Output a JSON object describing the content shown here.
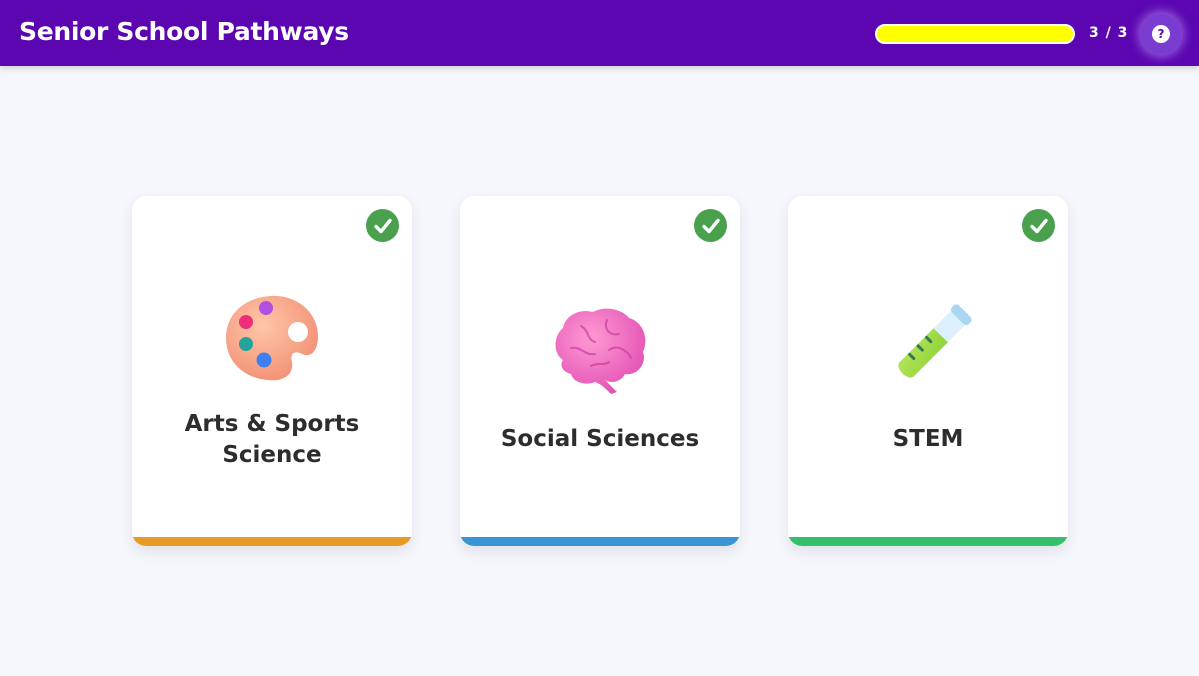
{
  "header": {
    "title": "Senior School Pathways",
    "progress": {
      "current": 3,
      "total": 3,
      "fraction": 1.0,
      "text": "3 / 3",
      "fill_color": "#ffff00"
    },
    "help_label": "?"
  },
  "colors": {
    "header_bg": "#5b06b1",
    "page_bg": "#f6f7fc",
    "check_bg": "#4aa14d"
  },
  "pathways": [
    {
      "label_line1": "Arts & Sports",
      "label_line2": "Science",
      "icon": "palette-icon",
      "accent": "#e89a26",
      "completed": true
    },
    {
      "label_line1": "Social Sciences",
      "label_line2": "",
      "icon": "brain-icon",
      "accent": "#3a93d3",
      "completed": true
    },
    {
      "label_line1": "STEM",
      "label_line2": "",
      "icon": "test-tube-icon",
      "accent": "#34c06a",
      "completed": true
    }
  ]
}
